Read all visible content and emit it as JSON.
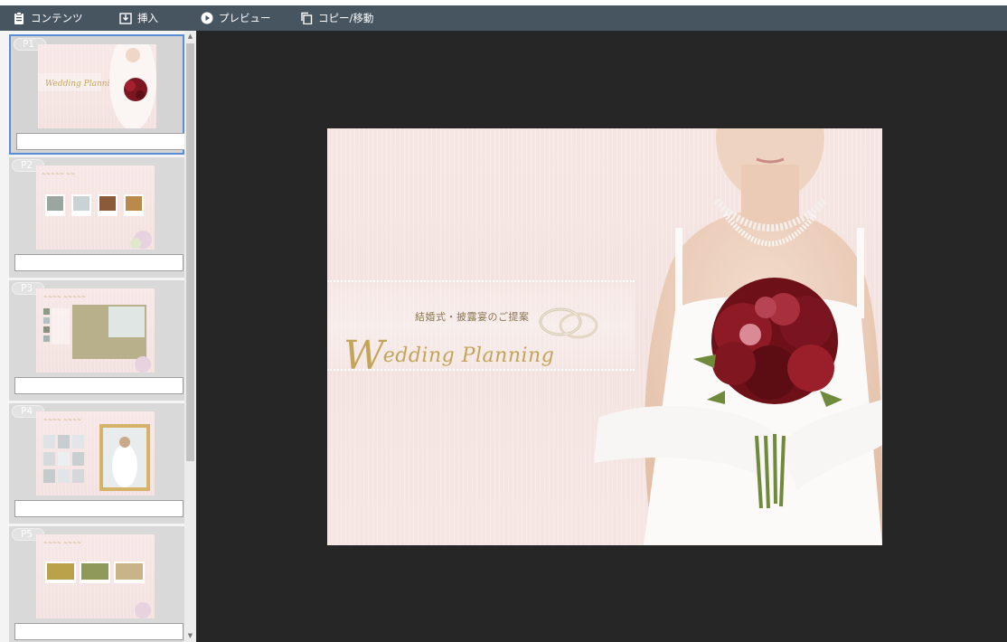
{
  "toolbar": {
    "contents_label": "コンテンツ",
    "insert_label": "挿入",
    "preview_label": "プレビュー",
    "copy_move_label": "コピー/移動"
  },
  "pages": [
    {
      "badge": "P1",
      "selected": true,
      "note": ""
    },
    {
      "badge": "P2",
      "selected": false,
      "note": ""
    },
    {
      "badge": "P3",
      "selected": false,
      "note": ""
    },
    {
      "badge": "P4",
      "selected": false,
      "note": ""
    },
    {
      "badge": "P5",
      "selected": false,
      "note": ""
    }
  ],
  "slide": {
    "subtitle": "結婚式・披露宴のご提案",
    "title_initial": "W",
    "title_rest": "edding  Planning"
  },
  "colors": {
    "toolbar_bg": "#475561",
    "canvas_bg": "#262626",
    "selected_border": "#5b8dd6",
    "gold": "#c3a55a"
  }
}
